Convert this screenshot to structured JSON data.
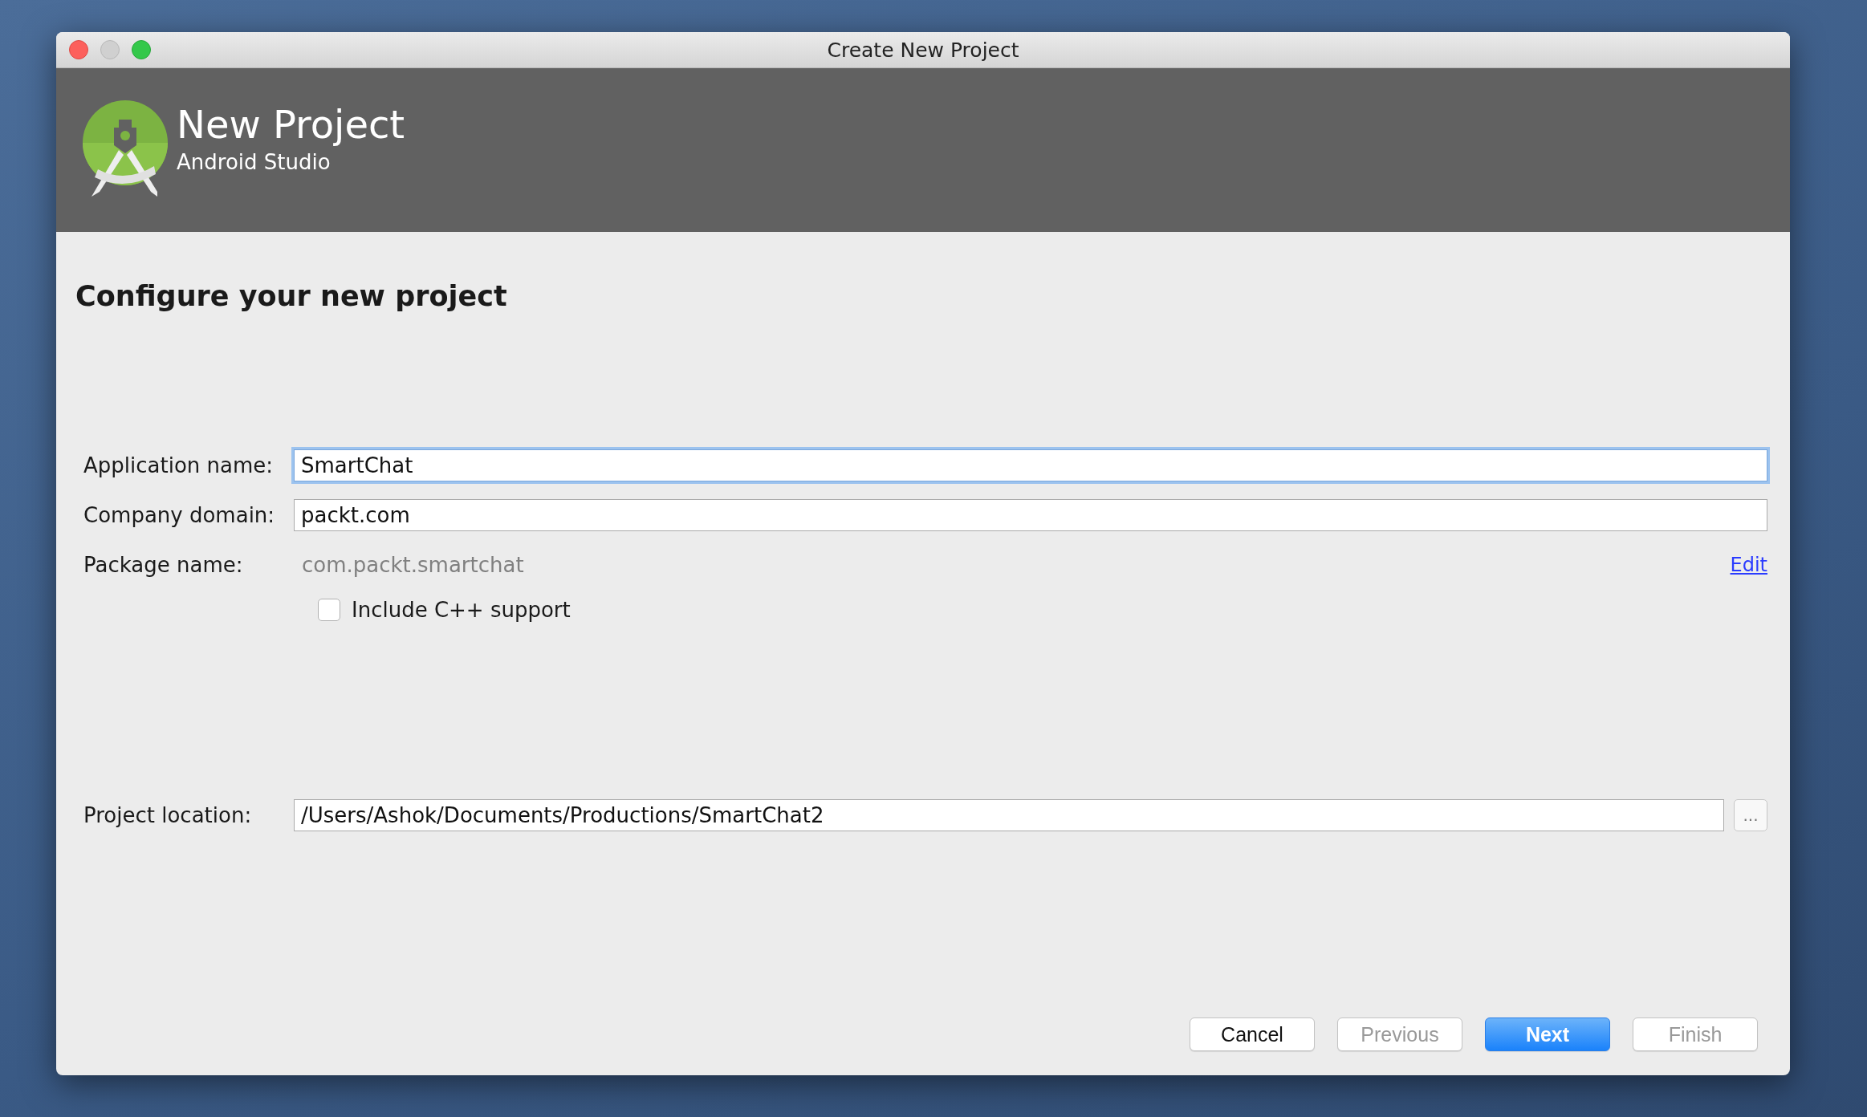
{
  "window": {
    "title": "Create New Project"
  },
  "header": {
    "title": "New Project",
    "subtitle": "Android Studio"
  },
  "heading": "Configure your new project",
  "fields": [
    {
      "label": "Application name:",
      "value": "SmartChat",
      "focused": true
    },
    {
      "label": "Company domain:",
      "value": "packt.com",
      "focused": false
    }
  ],
  "package": {
    "label": "Package name:",
    "value": "com.packt.smartchat",
    "link": "Edit"
  },
  "cpp_support": {
    "label": "Include C++ support",
    "checked": false
  },
  "location": {
    "label": "Project location:",
    "value": "/Users/Ashok/Documents/Productions/SmartChat2",
    "browse": "..."
  },
  "buttons": [
    {
      "label": "Cancel",
      "disabled": false,
      "primary": false
    },
    {
      "label": "Previous",
      "disabled": true,
      "primary": false
    },
    {
      "label": "Next",
      "disabled": false,
      "primary": true
    },
    {
      "label": "Finish",
      "disabled": true,
      "primary": false
    }
  ]
}
